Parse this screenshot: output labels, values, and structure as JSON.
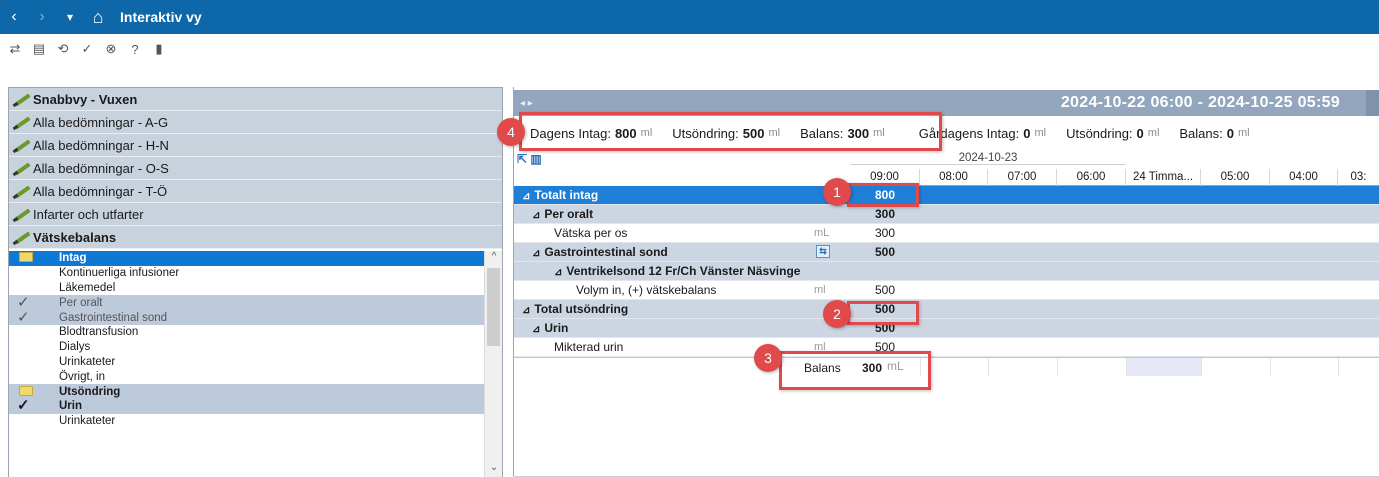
{
  "window": {
    "title": "Interaktiv vy",
    "nav": {
      "back": "‹",
      "forward": "›",
      "menu": "▾",
      "home": "⌂"
    }
  },
  "toolbar": {
    "icons": [
      "connect-icon",
      "layout-icon",
      "refresh-icon",
      "check-icon",
      "cancel-icon",
      "help-icon",
      "trash-icon"
    ],
    "glyphs": [
      "⇄",
      "▤",
      "⟲",
      "✓",
      "⊗",
      "?",
      "▮"
    ]
  },
  "sidebar": {
    "categories": [
      {
        "label": "Snabbvy - Vuxen",
        "bold": true
      },
      {
        "label": "Alla bedömningar - A-G",
        "bold": false
      },
      {
        "label": "Alla bedömningar - H-N",
        "bold": false
      },
      {
        "label": "Alla bedömningar - O-S",
        "bold": false
      },
      {
        "label": "Alla bedömningar - T-Ö",
        "bold": false
      },
      {
        "label": "Infarter och utfarter",
        "bold": false
      },
      {
        "label": "Vätskebalans",
        "bold": true
      }
    ],
    "items": [
      {
        "label": "Intag",
        "kind": "folder-selected",
        "check": ""
      },
      {
        "label": "Kontinuerliga infusioner",
        "kind": "plain",
        "check": ""
      },
      {
        "label": "Läkemedel",
        "kind": "plain",
        "check": ""
      },
      {
        "label": "Per oralt",
        "kind": "shade",
        "check": "✓"
      },
      {
        "label": "Gastrointestinal sond",
        "kind": "shade",
        "check": "✓"
      },
      {
        "label": "Blodtransfusion",
        "kind": "plain",
        "check": ""
      },
      {
        "label": "Dialys",
        "kind": "plain",
        "check": ""
      },
      {
        "label": "Urinkateter",
        "kind": "plain",
        "check": ""
      },
      {
        "label": "Övrigt, in",
        "kind": "plain",
        "check": ""
      },
      {
        "label": "Utsöndring",
        "kind": "folder-group",
        "check": ""
      },
      {
        "label": "Urin",
        "kind": "group",
        "check": "✓"
      },
      {
        "label": "Urinkateter",
        "kind": "plain",
        "check": ""
      }
    ]
  },
  "flowsheet": {
    "date_range": "2024-10-22 06:00 - 2024-10-25 05:59",
    "summary": {
      "today_label": "Dagens Intag:",
      "today_intake": "800",
      "today_output_label": "Utsöndring:",
      "today_output": "500",
      "today_balance_label": "Balans:",
      "today_balance": "300",
      "unit": "ml",
      "yesterday_label": "Gårdagens Intag:",
      "yesterday_intake": "0",
      "yesterday_output_label": "Utsöndring:",
      "yesterday_output": "0",
      "yesterday_balance_label": "Balans:",
      "yesterday_balance": "0"
    },
    "date_header": "2024-10-23",
    "times": [
      "09:00",
      "08:00",
      "07:00",
      "06:00",
      "24 Timma...",
      "05:00",
      "04:00",
      "03:"
    ],
    "rows": [
      {
        "label": "Totalt intag",
        "value": "800",
        "style": "hl",
        "indent": 0,
        "tri": "⊿",
        "unit": ""
      },
      {
        "label": "Per oralt",
        "value": "300",
        "style": "sub",
        "indent": 1,
        "tri": "⊿",
        "unit": ""
      },
      {
        "label": "Vätska per os",
        "value": "300",
        "style": "plain",
        "indent": 2,
        "tri": "",
        "unit": "mL"
      },
      {
        "label": "Gastrointestinal sond",
        "value": "500",
        "style": "sub",
        "indent": 1,
        "tri": "⊿",
        "unit": ""
      },
      {
        "label": "Ventrikelsond 12 Fr/Ch Vänster Näsvinge",
        "value": "",
        "style": "sub",
        "indent": 2,
        "tri": "⊿",
        "unit": ""
      },
      {
        "label": "Volym in, (+) vätskebalans",
        "value": "500",
        "style": "plain",
        "indent": 3,
        "tri": "",
        "unit": "ml"
      },
      {
        "label": "Total utsöndring",
        "value": "500",
        "style": "sub",
        "indent": 0,
        "tri": "⊿",
        "unit": ""
      },
      {
        "label": "Urin",
        "value": "500",
        "style": "sub",
        "indent": 1,
        "tri": "⊿",
        "unit": ""
      },
      {
        "label": "Mikterad urin",
        "value": "500",
        "style": "plain",
        "indent": 2,
        "tri": "",
        "unit": "ml"
      }
    ],
    "balance": {
      "label": "Balans",
      "value": "300",
      "unit": "mL"
    }
  },
  "callouts": [
    "1",
    "2",
    "3",
    "4"
  ]
}
